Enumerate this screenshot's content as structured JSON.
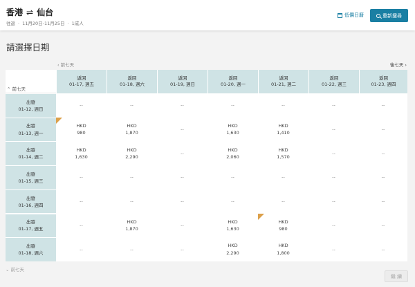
{
  "header": {
    "origin": "香港",
    "swap_symbol": "⇌",
    "destination": "仙台",
    "trip_type": "往返",
    "date_range": "11月20日-11月25日",
    "passengers": "1成人",
    "low_price_label": "低價日曆",
    "research_label": "重新搜尋"
  },
  "page_title": "請選擇日期",
  "nav": {
    "prev_week": "‹ 前七天",
    "next_week": "後七天 ›",
    "prev_days_top": "⌃ 前七天",
    "prev_days_bottom": "⌄ 前七天"
  },
  "columns": [
    {
      "type": "返回",
      "date": "01-17, 週五"
    },
    {
      "type": "返回",
      "date": "01-18, 週六"
    },
    {
      "type": "返回",
      "date": "01-19, 週日"
    },
    {
      "type": "返回",
      "date": "01-20, 週一"
    },
    {
      "type": "返回",
      "date": "01-21, 週二"
    },
    {
      "type": "返回",
      "date": "01-22, 週三"
    },
    {
      "type": "返回",
      "date": "01-23, 週四"
    }
  ],
  "rows": [
    {
      "type": "出發",
      "date": "01-12, 週日",
      "cells": [
        {
          "price": "--"
        },
        {
          "price": "--"
        },
        {
          "price": "--"
        },
        {
          "price": "--"
        },
        {
          "price": "--"
        },
        {
          "price": "--"
        },
        {
          "price": "--"
        }
      ]
    },
    {
      "type": "出發",
      "date": "01-13, 週一",
      "cells": [
        {
          "currency": "HKD",
          "price": "980",
          "flag": true
        },
        {
          "currency": "HKD",
          "price": "1,870"
        },
        {
          "price": "--"
        },
        {
          "currency": "HKD",
          "price": "1,630"
        },
        {
          "currency": "HKD",
          "price": "1,410"
        },
        {
          "price": "--"
        },
        {
          "price": "--"
        }
      ]
    },
    {
      "type": "出發",
      "date": "01-14, 週二",
      "cells": [
        {
          "currency": "HKD",
          "price": "1,630"
        },
        {
          "currency": "HKD",
          "price": "2,290"
        },
        {
          "price": "--"
        },
        {
          "currency": "HKD",
          "price": "2,060"
        },
        {
          "currency": "HKD",
          "price": "1,570"
        },
        {
          "price": "--"
        },
        {
          "price": "--"
        }
      ]
    },
    {
      "type": "出發",
      "date": "01-15, 週三",
      "cells": [
        {
          "price": "--"
        },
        {
          "price": "--"
        },
        {
          "price": "--"
        },
        {
          "price": "--"
        },
        {
          "price": "--"
        },
        {
          "price": "--"
        },
        {
          "price": "--"
        }
      ]
    },
    {
      "type": "出發",
      "date": "01-16, 週四",
      "cells": [
        {
          "price": "--"
        },
        {
          "price": "--"
        },
        {
          "price": "--"
        },
        {
          "price": "--"
        },
        {
          "price": "--"
        },
        {
          "price": "--"
        },
        {
          "price": "--"
        }
      ]
    },
    {
      "type": "出發",
      "date": "01-17, 週五",
      "cells": [
        {
          "price": "--"
        },
        {
          "currency": "HKD",
          "price": "1,870"
        },
        {
          "price": "--"
        },
        {
          "currency": "HKD",
          "price": "1,630"
        },
        {
          "currency": "HKD",
          "price": "980",
          "flag": true
        },
        {
          "price": "--"
        },
        {
          "price": "--"
        }
      ]
    },
    {
      "type": "出發",
      "date": "01-18, 週六",
      "cells": [
        {
          "price": "--"
        },
        {
          "price": "--"
        },
        {
          "price": "--"
        },
        {
          "currency": "HKD",
          "price": "2,290"
        },
        {
          "currency": "HKD",
          "price": "1,800"
        },
        {
          "price": "--"
        },
        {
          "price": "--"
        }
      ]
    }
  ],
  "continue_label": "繼 續",
  "colors": {
    "accent": "#1a7fa3",
    "header_cell_bg": "#cfe3e5",
    "flag": "#dca04a"
  }
}
